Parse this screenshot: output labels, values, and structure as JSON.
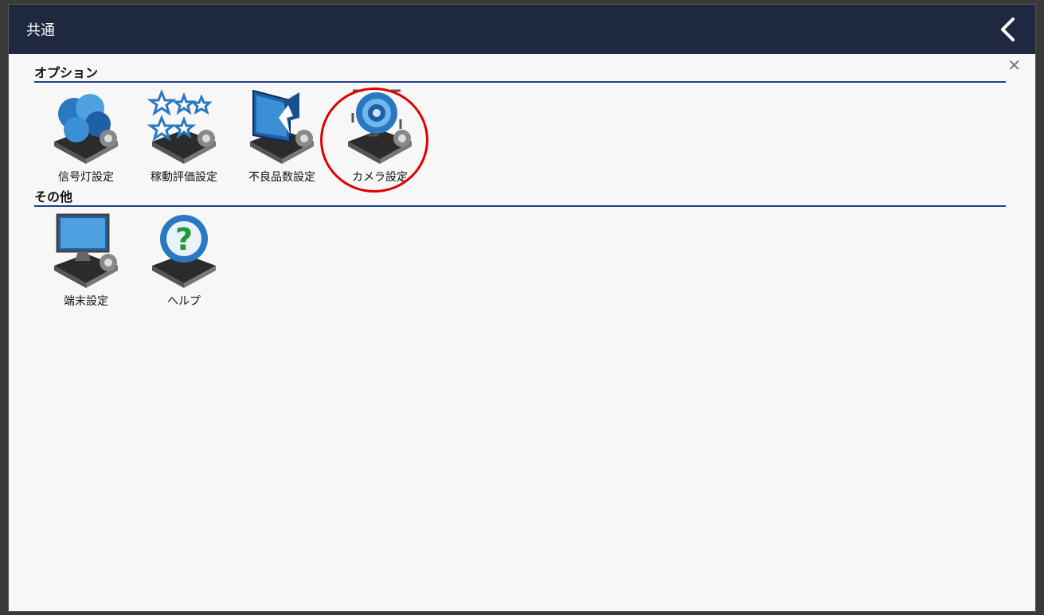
{
  "header": {
    "title": "共通"
  },
  "sections": [
    {
      "title": "オプション",
      "items": [
        {
          "label": "信号灯設定",
          "icon": "signal-light-settings-icon"
        },
        {
          "label": "稼動評価設定",
          "icon": "operation-rating-settings-icon"
        },
        {
          "label": "不良品数設定",
          "icon": "defect-count-settings-icon"
        },
        {
          "label": "カメラ設定",
          "icon": "camera-settings-icon"
        }
      ]
    },
    {
      "title": "その他",
      "items": [
        {
          "label": "端末設定",
          "icon": "terminal-settings-icon"
        },
        {
          "label": "ヘルプ",
          "icon": "help-icon"
        }
      ]
    }
  ],
  "colors": {
    "header_bg": "#1e2940",
    "section_rule": "#1f3f8f",
    "highlight": "#e00000"
  }
}
